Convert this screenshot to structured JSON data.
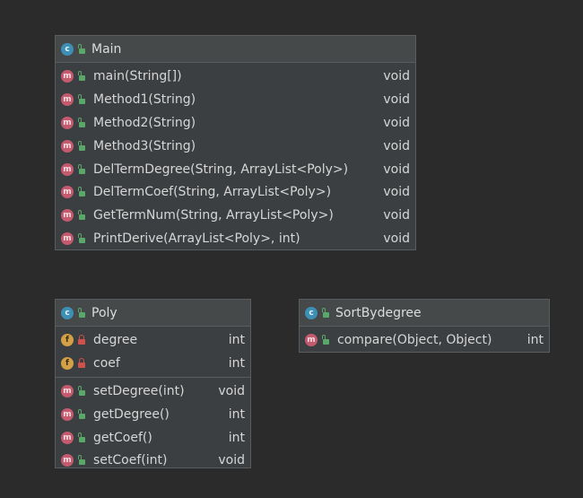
{
  "classes": {
    "main": {
      "name": "Main",
      "icon": "class-icon",
      "methods": [
        {
          "name": "main(String[])",
          "type": "void"
        },
        {
          "name": "Method1(String)",
          "type": "void"
        },
        {
          "name": "Method2(String)",
          "type": "void"
        },
        {
          "name": "Method3(String)",
          "type": "void"
        },
        {
          "name": "DelTermDegree(String, ArrayList<Poly>)",
          "type": "void"
        },
        {
          "name": "DelTermCoef(String, ArrayList<Poly>)",
          "type": "void"
        },
        {
          "name": "GetTermNum(String, ArrayList<Poly>)",
          "type": "void"
        },
        {
          "name": "PrintDerive(ArrayList<Poly>, int)",
          "type": "void"
        }
      ]
    },
    "poly": {
      "name": "Poly",
      "icon": "class-icon",
      "fields": [
        {
          "name": "degree",
          "type": "int"
        },
        {
          "name": "coef",
          "type": "int"
        }
      ],
      "methods": [
        {
          "name": "setDegree(int)",
          "type": "void"
        },
        {
          "name": "getDegree()",
          "type": "int"
        },
        {
          "name": "getCoef()",
          "type": "int"
        },
        {
          "name": "setCoef(int)",
          "type": "void"
        }
      ]
    },
    "sortbydegree": {
      "name": "SortBydegree",
      "icon": "class-icon",
      "methods": [
        {
          "name": "compare(Object, Object)",
          "type": "int"
        }
      ]
    }
  },
  "badges": {
    "class": "c",
    "method": "m",
    "field": "f"
  },
  "colors": {
    "background": "#2b2b2b",
    "box": "#3c3f41",
    "class_badge": "#3d8fb5",
    "method_badge": "#c45a6e",
    "field_badge": "#d3a047",
    "public_lock": "#59a869",
    "private_lock": "#d0504a"
  }
}
